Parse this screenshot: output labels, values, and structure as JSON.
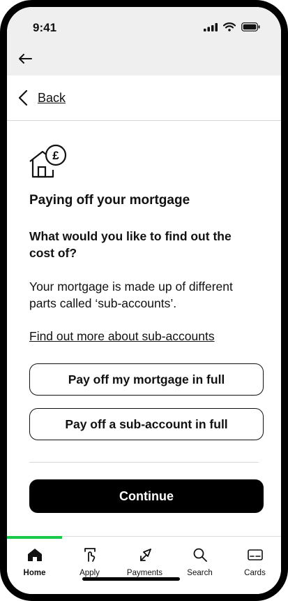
{
  "status_bar": {
    "time": "9:41"
  },
  "nav": {
    "back_label": "Back"
  },
  "main": {
    "title": "Paying off your mortgage",
    "question": "What would you like to find out the cost of?",
    "paragraph": "Your mortgage is made up of different parts called ‘sub-accounts’.",
    "more_link": "Find out more about sub-accounts",
    "options": [
      {
        "label": "Pay off my mortgage in full"
      },
      {
        "label": "Pay off a sub-account in full"
      }
    ],
    "continue_label": "Continue"
  },
  "tabbar": {
    "items": [
      {
        "label": "Home",
        "icon": "home-icon"
      },
      {
        "label": "Apply",
        "icon": "apply-icon"
      },
      {
        "label": "Payments",
        "icon": "payments-icon"
      },
      {
        "label": "Search",
        "icon": "search-icon"
      },
      {
        "label": "Cards",
        "icon": "card-icon"
      }
    ],
    "active_color": "#18c94a"
  }
}
